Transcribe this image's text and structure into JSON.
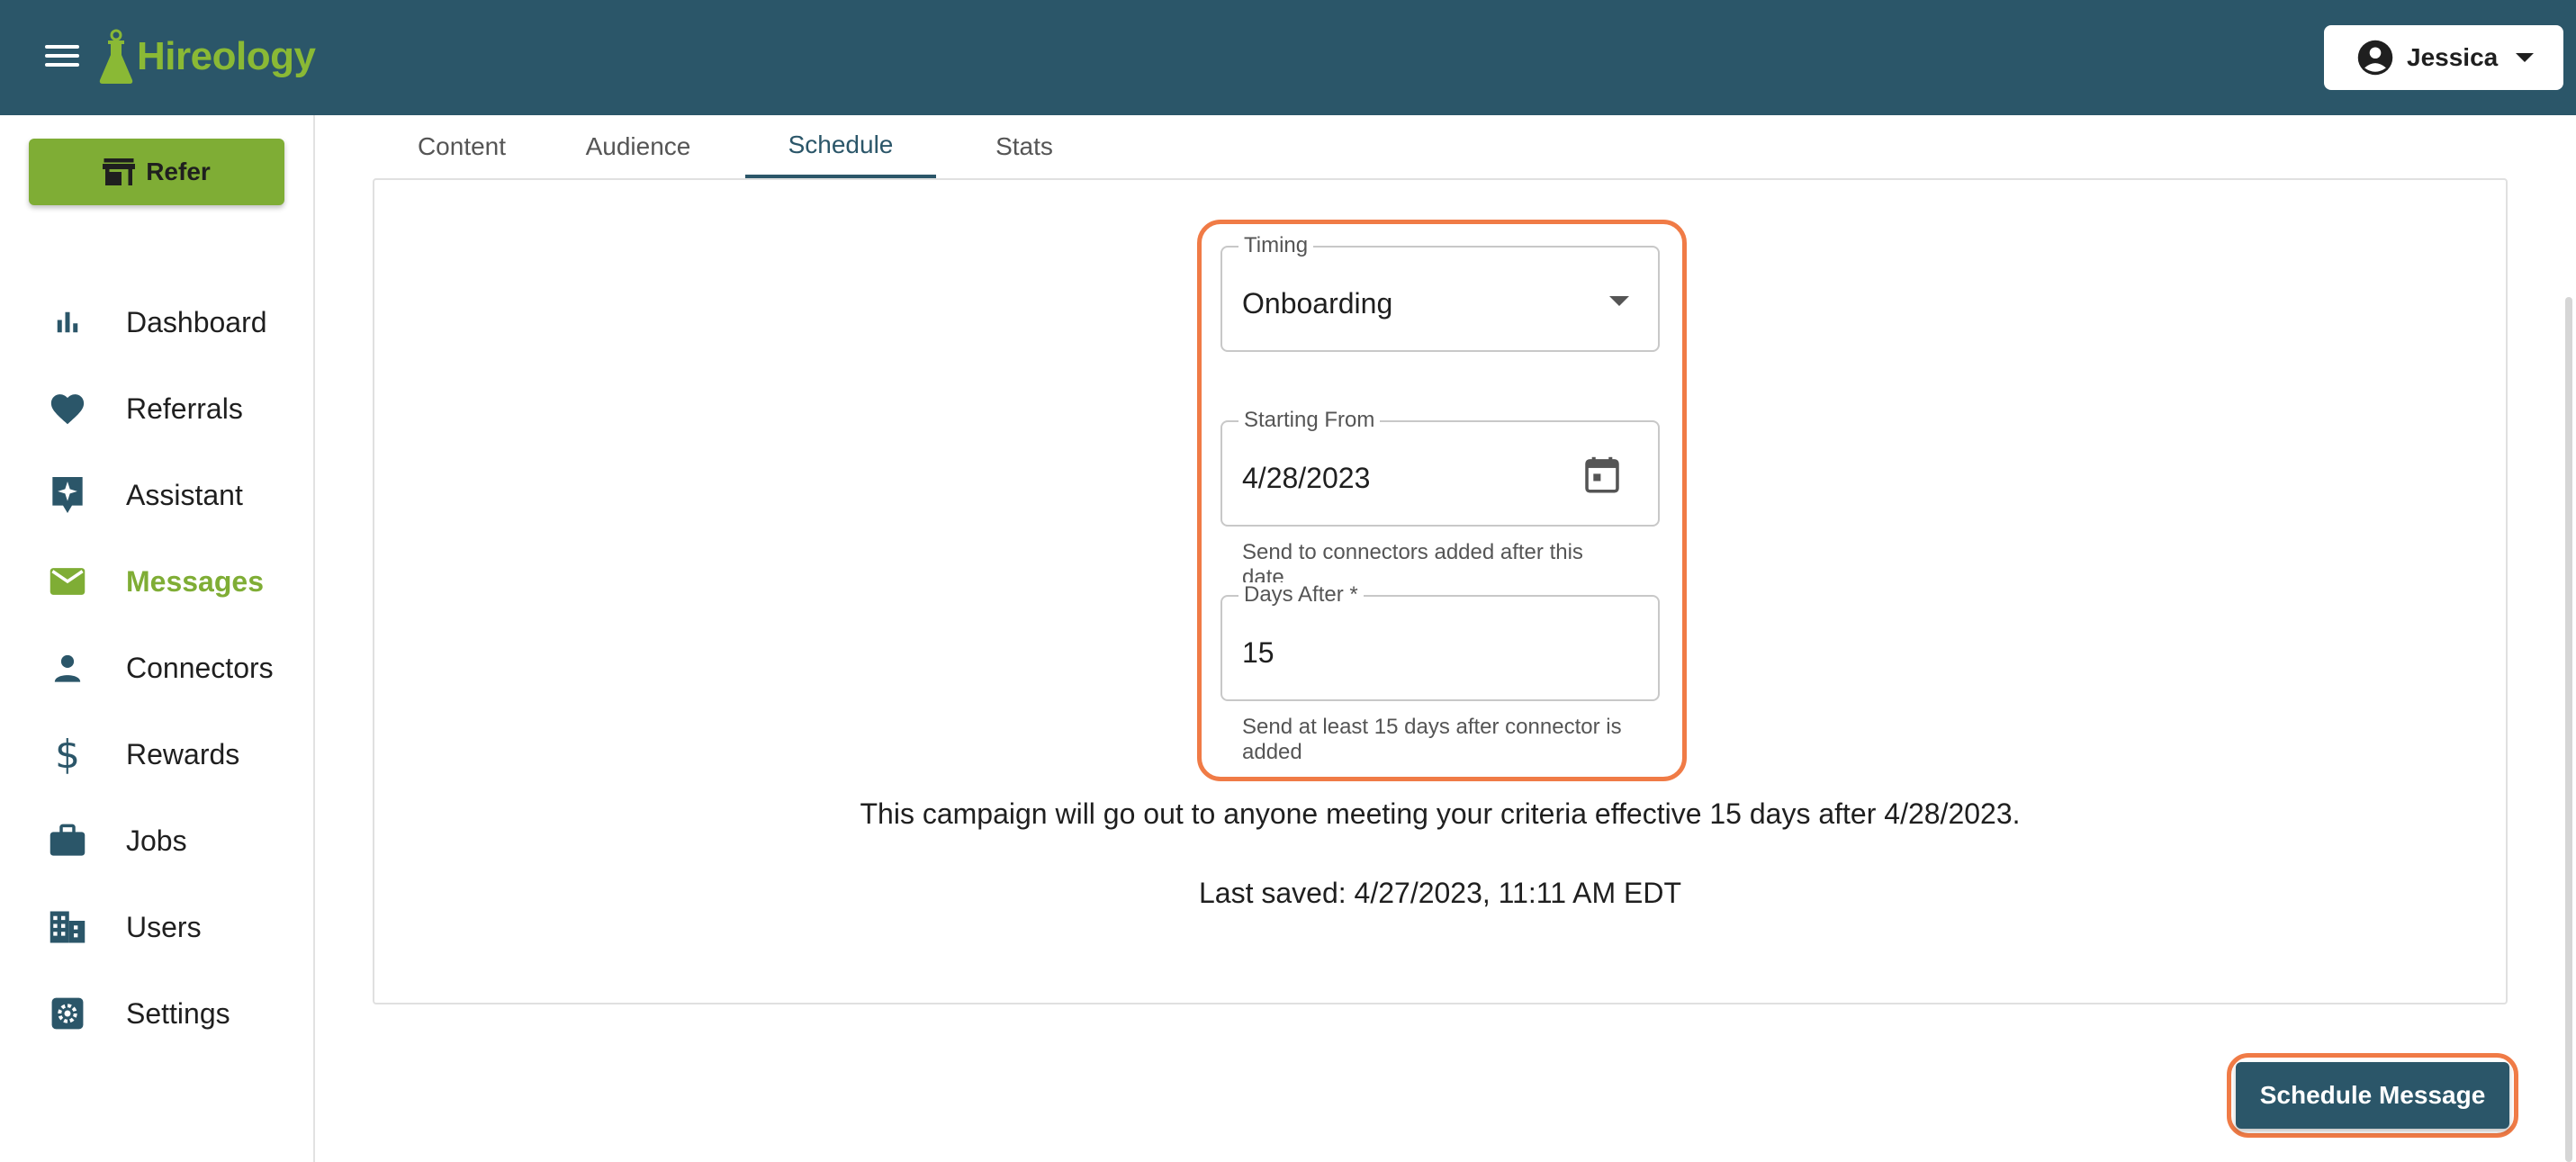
{
  "header": {
    "brand": "Hireology",
    "user_name": "Jessica"
  },
  "sidebar": {
    "refer_label": "Refer",
    "items": [
      {
        "label": "Dashboard",
        "icon": "bar-chart-icon"
      },
      {
        "label": "Referrals",
        "icon": "heart-icon"
      },
      {
        "label": "Assistant",
        "icon": "sparkle-icon"
      },
      {
        "label": "Messages",
        "icon": "mail-icon",
        "active": true
      },
      {
        "label": "Connectors",
        "icon": "person-icon"
      },
      {
        "label": "Rewards",
        "icon": "dollar-icon"
      },
      {
        "label": "Jobs",
        "icon": "briefcase-icon"
      },
      {
        "label": "Users",
        "icon": "building-icon"
      },
      {
        "label": "Settings",
        "icon": "gear-icon"
      }
    ]
  },
  "tabs": [
    {
      "label": "Content"
    },
    {
      "label": "Audience"
    },
    {
      "label": "Schedule",
      "active": true
    },
    {
      "label": "Stats"
    }
  ],
  "form": {
    "timing": {
      "label": "Timing",
      "value": "Onboarding"
    },
    "starting_from": {
      "label": "Starting From",
      "value": "4/28/2023",
      "helper": "Send to connectors added after this date"
    },
    "days_after": {
      "label": "Days After *",
      "value": "15",
      "helper": "Send at least 15 days after connector is added"
    }
  },
  "summary": {
    "text": "This campaign will go out to anyone meeting your criteria effective 15 days after 4/28/2023.",
    "last_saved": "Last saved: 4/27/2023, 11:11 AM EDT"
  },
  "actions": {
    "schedule_label": "Schedule Message"
  },
  "colors": {
    "header_bg": "#2b5669",
    "brand_green": "#7fad35",
    "highlight": "#f07b46"
  }
}
